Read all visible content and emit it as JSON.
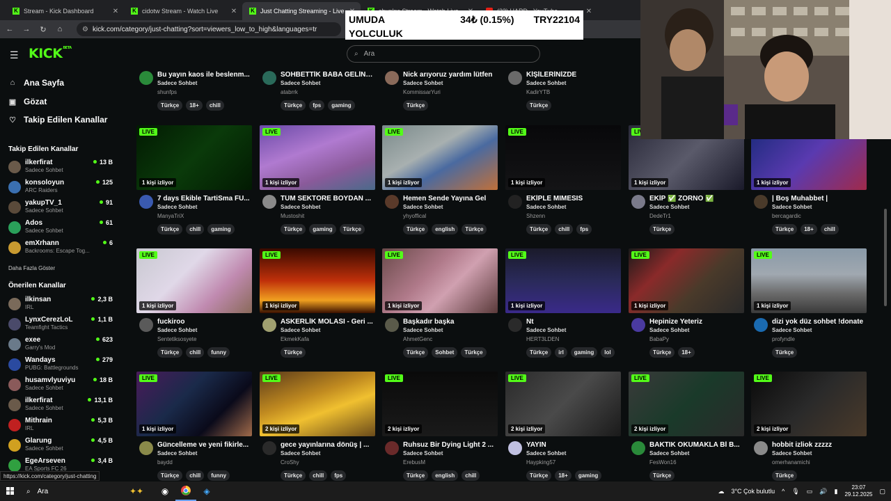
{
  "browser": {
    "tabs": [
      {
        "label": "Stream - Kick Dashboard",
        "icon": "kick-favicon"
      },
      {
        "label": "cidotw Stream - Watch Live",
        "icon": "kick-favicon"
      },
      {
        "label": "Just Chatting Streaming - Live",
        "icon": "kick-favicon"
      },
      {
        "label": "shuplns Stream - Watch Live",
        "icon": "kick-favicon"
      },
      {
        "label": "(33) HARD - YouTube",
        "icon": "youtube-favicon"
      }
    ],
    "url": "kick.com/category/just-chatting?sort=viewers_low_to_high&languages=tr"
  },
  "ticker": {
    "title_line1": "UMUDA",
    "price": "34₺ (0.15%)",
    "goal": "TRY22104",
    "title_line2": "YOLCULUK"
  },
  "header": {
    "logo": "KICK",
    "logo_sup": "BETA",
    "search_placeholder": "Ara"
  },
  "nav": [
    {
      "label": "Ana Sayfa",
      "icon": "home-icon"
    },
    {
      "label": "Gözat",
      "icon": "browse-icon"
    },
    {
      "label": "Takip Edilen Kanallar",
      "icon": "heart-icon"
    }
  ],
  "followed": {
    "title": "Takip Edilen Kanallar",
    "more": "Daha Fazla Göster",
    "channels": [
      {
        "name": "ilkerfirat",
        "category": "Sadece Sohbet",
        "viewers": "13 B",
        "color": "#6a5a4a"
      },
      {
        "name": "konsoloyun",
        "category": "ARC Raiders",
        "viewers": "125",
        "color": "#3a6fb0"
      },
      {
        "name": "yakupTV_1",
        "category": "Sadece Sohbet",
        "viewers": "91",
        "color": "#5a4a3a"
      },
      {
        "name": "Ados",
        "category": "Sadece Sohbet",
        "viewers": "61",
        "color": "#2aa05a"
      },
      {
        "name": "emXrhann",
        "category": "Backrooms: Escape Tog...",
        "viewers": "6",
        "color": "#c89a30"
      }
    ]
  },
  "recommended": {
    "title": "Önerilen Kanallar",
    "channels": [
      {
        "name": "ilkinsan",
        "category": "IRL",
        "viewers": "2,3 B",
        "color": "#7a6a5a"
      },
      {
        "name": "LynxCerezLoL",
        "category": "Teamfight Tactics",
        "viewers": "1,1 B",
        "color": "#4a4a6a"
      },
      {
        "name": "exee",
        "category": "Garry's Mod",
        "viewers": "623",
        "color": "#6a7a8a"
      },
      {
        "name": "Wandays",
        "category": "PUBG: Battlegrounds",
        "viewers": "279",
        "color": "#2a4aa0"
      },
      {
        "name": "husamvlyuviyu",
        "category": "Sadece Sohbet",
        "viewers": "18 B",
        "color": "#8a5a5a"
      },
      {
        "name": "ilkerfirat",
        "category": "Sadece Sohbet",
        "viewers": "13,1 B",
        "color": "#6a5a4a"
      },
      {
        "name": "Mithrain",
        "category": "IRL",
        "viewers": "5,3 B",
        "color": "#c02020"
      },
      {
        "name": "Glarung",
        "category": "Sadece Sohbet",
        "viewers": "4,5 B",
        "color": "#d0a020"
      },
      {
        "name": "EgeArseven",
        "category": "EA Sports FC 26",
        "viewers": "3,4 B",
        "color": "#30a040"
      }
    ]
  },
  "labels": {
    "live": "LIVE"
  },
  "rows": [
    [
      {
        "title": "Bu yayın kaos ile beslenm...",
        "category": "Sadece Sohbet",
        "streamer": "shunfps",
        "viewers": "",
        "tags": [
          "Türkçe",
          "18+",
          "chill"
        ],
        "thumb": "#111",
        "avatar": "#2a8a3a"
      },
      {
        "title": "SOHBETTİK BABA GELİN:...",
        "category": "Sadece Sohbet",
        "streamer": "atabrrk",
        "viewers": "",
        "tags": [
          "Türkçe",
          "fps",
          "gaming"
        ],
        "thumb": "#111",
        "avatar": "#2a6a5a"
      },
      {
        "title": "Nick arıyoruz yardım lütfen",
        "category": "Sadece Sohbet",
        "streamer": "KommissarYuri",
        "viewers": "",
        "tags": [
          "Türkçe"
        ],
        "thumb": "#111",
        "avatar": "#8a6a5a"
      },
      {
        "title": "KİŞİLERİNİZDE",
        "category": "Sadece Sohbet",
        "streamer": "KadirYTB",
        "viewers": "",
        "tags": [
          "Türkçe"
        ],
        "thumb": "#111",
        "avatar": "#6a6a6a"
      }
    ],
    [
      {
        "title": "7 days Ekible TartiSma FU...",
        "category": "Sadece Sohbet",
        "streamer": "ManyaTriX",
        "viewers": "1 kişi izliyor",
        "tags": [
          "Türkçe",
          "chill",
          "gaming"
        ],
        "thumb": "linear-gradient(135deg,#021a02,#0a3a0a 50%,#021a02)",
        "avatar": "#3a5ab0"
      },
      {
        "title": "TÜM SEKTÖRE BOYDAN ...",
        "category": "Sadece Sohbet",
        "streamer": "Mustoshit",
        "viewers": "1 kişi izliyor",
        "tags": [
          "Türkçe",
          "gaming",
          "Türkçe"
        ],
        "thumb": "linear-gradient(160deg,#6a4aa8,#b07ad0 40%,#8a5a9a 70%,#4a6a8a)",
        "avatar": "#8a8a8a"
      },
      {
        "title": "Hemen Sende Yayına Gel",
        "category": "Sadece Sohbet",
        "streamer": "yhyoffical",
        "viewers": "1 kişi izliyor",
        "tags": [
          "Türkçe",
          "english",
          "Türkçe"
        ],
        "thumb": "linear-gradient(150deg,#7a8a8a,#a8b0b0 40%,#4a6aa0 60%,#c0703a)",
        "avatar": "#5a3a2a"
      },
      {
        "title": "EKİPLE MIMESIS",
        "category": "Sadece Sohbet",
        "streamer": "Shzenn",
        "viewers": "1 kişi izliyor",
        "tags": [
          "Türkçe",
          "chill",
          "fps"
        ],
        "thumb": "linear-gradient(180deg,#08080a,#141416)",
        "avatar": "#222"
      },
      {
        "title": "EKİP ✅ ZORNO ✅",
        "category": "Sadece Sohbet",
        "streamer": "DedeTr1",
        "viewers": "1 kişi izliyor",
        "tags": [
          "Türkçe"
        ],
        "thumb": "linear-gradient(135deg,#2a2a3a,#5a5a6a 50%,#1a1a2a)",
        "avatar": "#7a7a8a"
      },
      {
        "title": "| Boş Muhabbet |",
        "category": "Sadece Sohbet",
        "streamer": "bercagardic",
        "viewers": "1 kişi izliyor",
        "tags": [
          "Türkçe",
          "18+",
          "chill"
        ],
        "thumb": "linear-gradient(135deg,#1a2a7a,#5a3ab0 50%,#a02a4a)",
        "avatar": "#4a3a2a"
      }
    ],
    [
      {
        "title": "fuckiroo",
        "category": "Sadece Sohbet",
        "streamer": "Sentetiksosyete",
        "viewers": "1 kişi izliyor",
        "tags": [
          "Türkçe",
          "chill",
          "funny"
        ],
        "thumb": "linear-gradient(135deg,#c8c8d0,#e0d8e8 40%,#c08ab0 70%,#8a6a5a)",
        "avatar": "#5a5a5a"
      },
      {
        "title": "ASKERLİK MOLASI - Geri ...",
        "category": "Sadece Sohbet",
        "streamer": "EkmekKafa",
        "viewers": "1 kişi izliyor",
        "tags": [
          "Türkçe"
        ],
        "thumb": "linear-gradient(180deg,#3a0a00,#c0300a 50%,#f0a020 80%,#3a1000)",
        "avatar": "#a0a070"
      },
      {
        "title": "Başkadır başka",
        "category": "Sadece Sohbet",
        "streamer": "AhmetGenc",
        "viewers": "1 kişi izliyor",
        "tags": [
          "Türkçe",
          "Sohbet",
          "Türkçe"
        ],
        "thumb": "linear-gradient(135deg,#6a4a4a,#b07a8a 40%,#d0a0b0 60%,#5a3a3a)",
        "avatar": "#5a5a4a"
      },
      {
        "title": "Nt",
        "category": "Sadece Sohbet",
        "streamer": "HERT3LDEN",
        "viewers": "1 kişi izliyor",
        "tags": [
          "Türkçe",
          "irl",
          "gaming",
          "lol"
        ],
        "thumb": "linear-gradient(180deg,#1a1a2a,#2a2a5a 50%,#3a2a8a)",
        "avatar": "#2a2a2a"
      },
      {
        "title": "Hepinize Yeteriz",
        "category": "Sadece Sohbet",
        "streamer": "BabaPy",
        "viewers": "1 kişi izliyor",
        "tags": [
          "Türkçe",
          "18+"
        ],
        "thumb": "linear-gradient(135deg,#1a1a1a,#8a2a2a 30%,#4a3a2a 60%,#2a2a2a)",
        "avatar": "#4a3aa0"
      },
      {
        "title": "dizi yok düz sohbet !donate",
        "category": "Sadece Sohbet",
        "streamer": "profyndle",
        "viewers": "1 kişi izliyor",
        "tags": [
          "Türkçe"
        ],
        "thumb": "linear-gradient(180deg,#8a9aa8,#a0a8b0 40%,#6a6a6a 70%,#3a3a3a)",
        "avatar": "#1a6ab0"
      }
    ],
    [
      {
        "title": "Güncelleme ve yeni fikirle...",
        "category": "Sadece Sohbet",
        "streamer": "baydd",
        "viewers": "1 kişi izliyor",
        "tags": [
          "Türkçe",
          "chill",
          "funny"
        ],
        "thumb": "linear-gradient(135deg,#4a1a5a,#1a2a4a 40%,#0a0a1a 70%,#a06a4a)",
        "avatar": "#8a8a4a"
      },
      {
        "title": "gece yayınlarına dönüş | ...",
        "category": "Sadece Sohbet",
        "streamer": "CroShy",
        "viewers": "2 kişi izliyor",
        "tags": [
          "Türkçe",
          "chill",
          "fps"
        ],
        "thumb": "linear-gradient(160deg,#5a3a1a,#c08a20 40%,#f0c030 60%,#6a4a1a)",
        "avatar": "#2a2a2a"
      },
      {
        "title": "Ruhsuz Bir Dying Light 2 ...",
        "category": "Sadece Sohbet",
        "streamer": "ErebusM",
        "viewers": "2 kişi izliyor",
        "tags": [
          "Türkçe",
          "english",
          "chill"
        ],
        "thumb": "linear-gradient(180deg,#0a0a0a,#1a1a1a)",
        "avatar": "#6a2a2a"
      },
      {
        "title": "YAYIN",
        "category": "Sadece Sohbet",
        "streamer": "Haypking57",
        "viewers": "2 kişi izliyor",
        "tags": [
          "Türkçe",
          "18+",
          "gaming"
        ],
        "thumb": "linear-gradient(135deg,#2a2a2a,#4a4a4a 50%,#1a1a1a)",
        "avatar": "#c0c0e0"
      },
      {
        "title": "BAKTIK OKUMAKLA Bİ B...",
        "category": "Sadece Sohbet",
        "streamer": "FesWon16",
        "viewers": "2 kişi izliyor",
        "tags": [
          "Türkçe"
        ],
        "thumb": "linear-gradient(135deg,#3a3a3a,#1a3a2a 50%,#2a2a2a)",
        "avatar": "#2a8a3a"
      },
      {
        "title": "hobbit izliok zzzzz",
        "category": "Sadece Sohbet",
        "streamer": "omerhanamichi",
        "viewers": "2 kişi izliyor",
        "tags": [
          "Türkçe"
        ],
        "thumb": "linear-gradient(135deg,#0a0a0a,#2a2a2a 50%,#4a3a2a)",
        "avatar": "#8a8a8a"
      }
    ]
  ],
  "statusbar": "https://kick.com/category/just-chatting",
  "taskbar": {
    "search": "Ara",
    "weather": "3°C  Çok bulutlu",
    "time": "23:07",
    "date": "29.12.2025"
  }
}
